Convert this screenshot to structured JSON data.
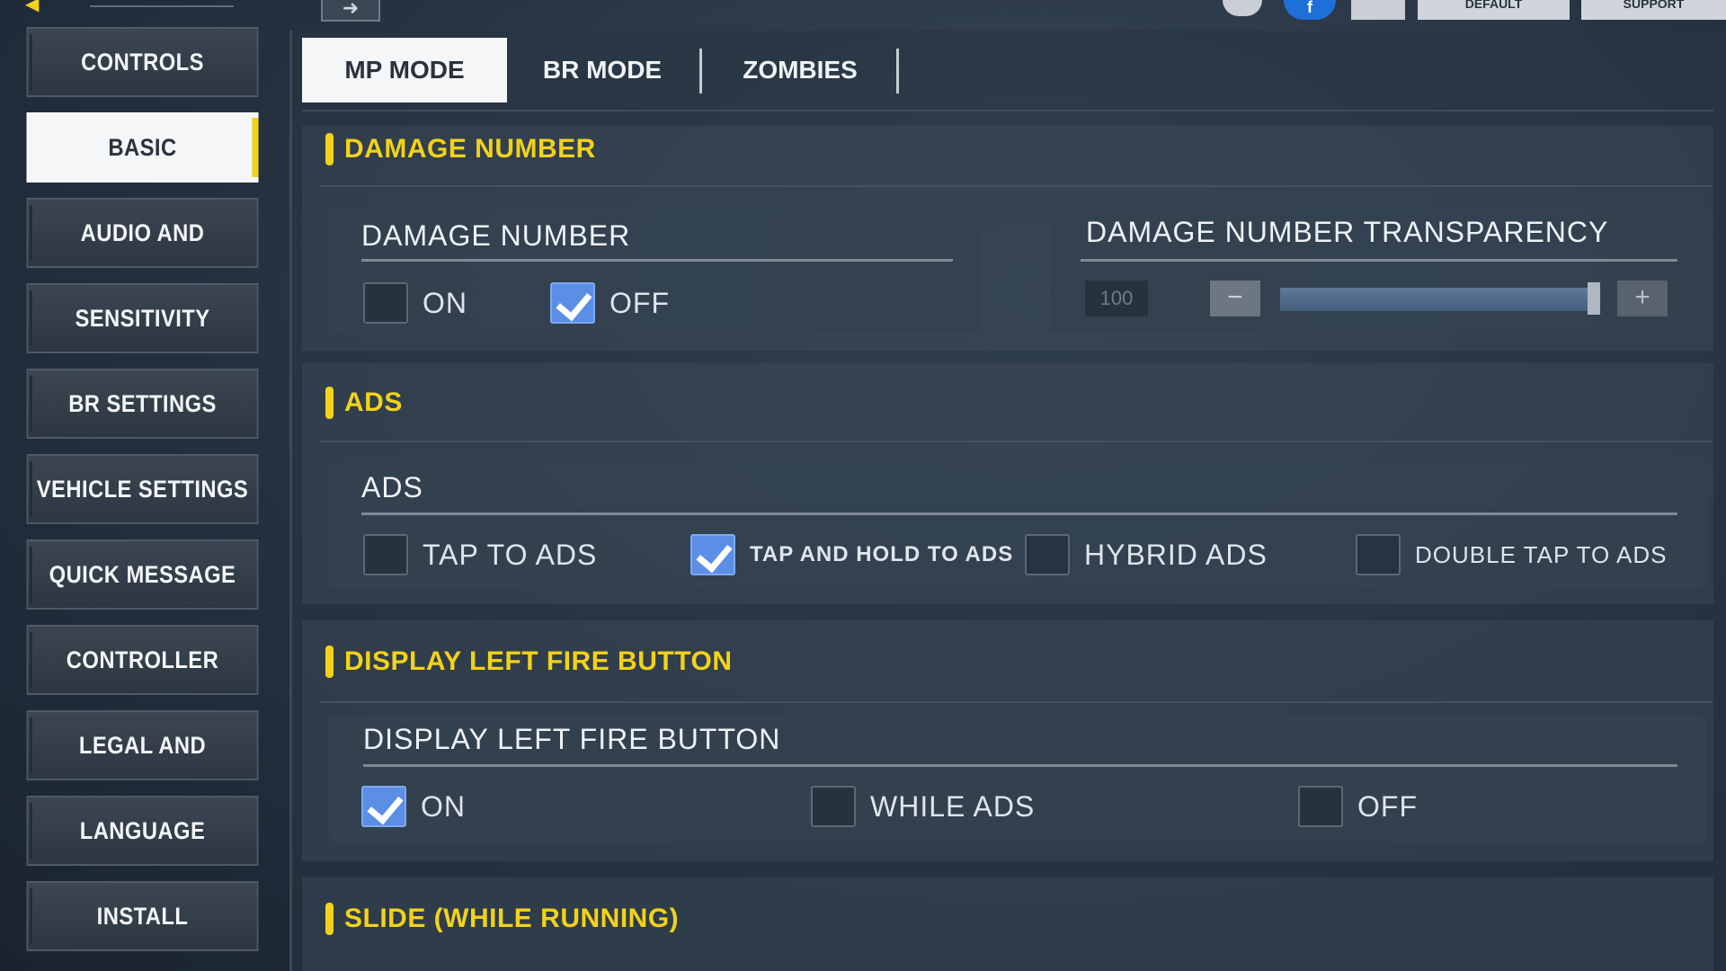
{
  "topbar": {
    "back_icon": "back-arrow-icon",
    "arrow_icon": "forward-arrow-icon",
    "default_label": "DEFAULT",
    "support_label": "SUPPORT"
  },
  "sidebar": {
    "items": [
      {
        "label": "CONTROLS"
      },
      {
        "label": "BASIC"
      },
      {
        "label": "AUDIO AND GRAPHICS"
      },
      {
        "label": "SENSITIVITY"
      },
      {
        "label": "BR SETTINGS"
      },
      {
        "label": "VEHICLE SETTINGS"
      },
      {
        "label": "QUICK MESSAGE"
      },
      {
        "label": "CONTROLLER"
      },
      {
        "label": "LEGAL AND PRIVACY"
      },
      {
        "label": "LANGUAGE"
      },
      {
        "label": "INSTALL"
      }
    ],
    "active_index": 1
  },
  "tabs": [
    {
      "label": "MP MODE"
    },
    {
      "label": "BR MODE"
    },
    {
      "label": "ZOMBIES"
    }
  ],
  "sections": {
    "damage_number": {
      "header": "DAMAGE NUMBER",
      "card_title": "DAMAGE NUMBER",
      "on_label": "ON",
      "off_label": "OFF",
      "transparency_title": "DAMAGE NUMBER TRANSPARENCY",
      "transparency_value": "100"
    },
    "ads": {
      "header": "ADS",
      "card_title": "ADS",
      "options": [
        "TAP TO ADS",
        "TAP AND HOLD TO ADS",
        "HYBRID ADS",
        "DOUBLE TAP TO ADS"
      ]
    },
    "left_fire": {
      "header": "DISPLAY LEFT FIRE BUTTON",
      "card_title": "DISPLAY LEFT FIRE BUTTON",
      "options": [
        "ON",
        "WHILE ADS",
        "OFF"
      ]
    },
    "slide": {
      "header": "SLIDE (WHILE RUNNING)"
    }
  },
  "colors": {
    "accent": "#f2d21a",
    "checkbox_checked": "#5b8fe6"
  }
}
